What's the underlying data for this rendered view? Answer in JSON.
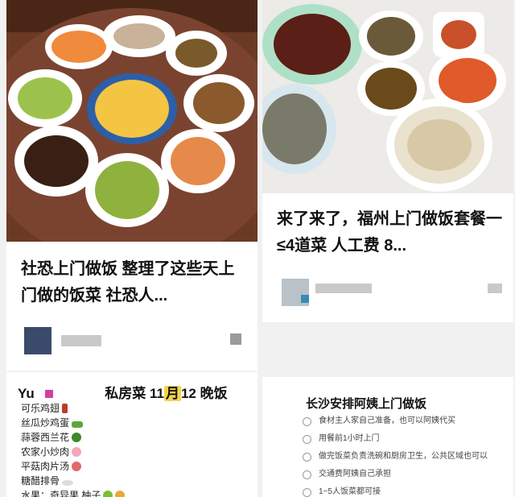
{
  "feed": {
    "cards": [
      {
        "title": "社恐上门做饭 整理了这些天上门做的饭菜 社恐人..."
      },
      {
        "title": "来了来了，福州上门做饭套餐一≤4道菜 人工费 8..."
      }
    ],
    "menu_card": {
      "prefix": "Yu",
      "title_suffix": "私房菜 11",
      "date_mark": "月",
      "title_end": "12 晚饭",
      "items": [
        "可乐鸡翅",
        "丝瓜炒鸡蛋",
        "蒜蓉西兰花",
        "农家小炒肉",
        "平菇肉片汤",
        "糖醋排骨",
        "水果：奇异果 柚子"
      ]
    },
    "service_card": {
      "title": "长沙安排阿姨上门做饭",
      "options": [
        "食材主人家自己准备，也可以阿姨代买",
        "用餐前1小时上门",
        "做完饭菜负责洗碗和厨房卫生，公共区域也可以",
        "交通费阿姨自己承担",
        "1~5人饭菜都可接"
      ]
    }
  },
  "colors": {
    "table_wood": "#6b3a24",
    "plate": "#ffffff",
    "date_highlight": "#f6d247"
  }
}
